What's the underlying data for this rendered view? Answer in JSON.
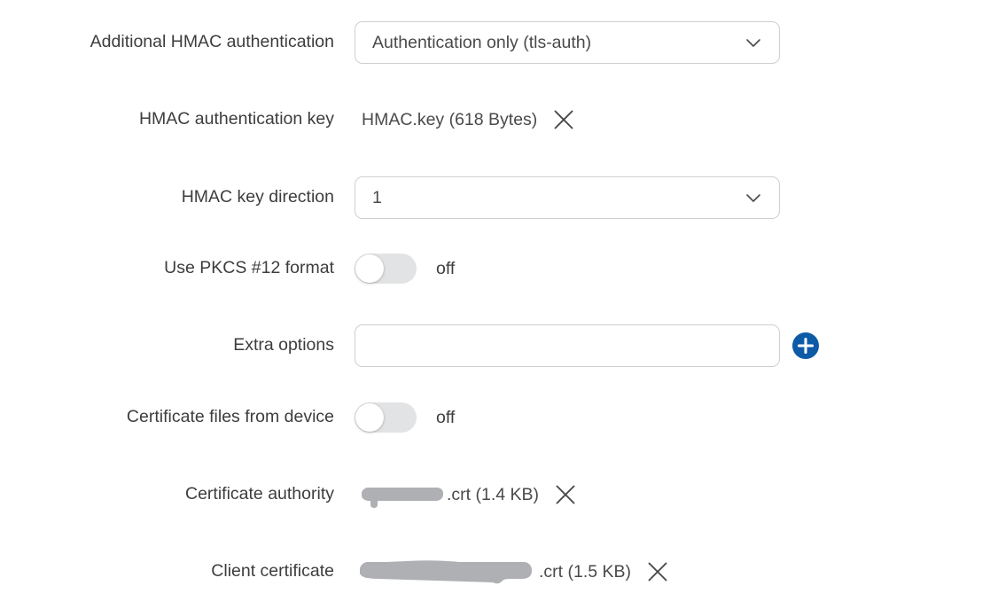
{
  "theme": {
    "background": "#ffffff",
    "label_color": "#3d3d3d",
    "value_color": "#4a4a4a",
    "border_color": "#cfcfcf",
    "accent_blue": "#0d5aa7",
    "toggle_track_off": "#e2e3e4",
    "toggle_knob": "#ffffff",
    "redaction_gray": "#aeb0b3",
    "icon_color": "#4a4a4a"
  },
  "form": {
    "rows": [
      {
        "id": "additional-hmac-authentication",
        "label": "Additional HMAC authentication",
        "type": "select",
        "value": "Authentication only (tls-auth)",
        "chevron_icon": "chevron-down-icon"
      },
      {
        "id": "hmac-authentication-key",
        "label": "HMAC authentication key",
        "type": "file",
        "filename": "HMAC.key",
        "size": "(618 Bytes)",
        "value": "HMAC.key (618 Bytes)",
        "redacted": false,
        "remove_icon": "close-icon"
      },
      {
        "id": "hmac-key-direction",
        "label": "HMAC key direction",
        "type": "select",
        "value": "1",
        "chevron_icon": "chevron-down-icon"
      },
      {
        "id": "use-pkcs-12-format",
        "label": "Use PKCS #12 format",
        "type": "toggle",
        "state": "off",
        "checked": false
      },
      {
        "id": "extra-options",
        "label": "Extra options",
        "type": "text-with-add",
        "value": "",
        "placeholder": "",
        "add_icon": "plus-icon"
      },
      {
        "id": "certificate-files-from-device",
        "label": "Certificate files from device",
        "type": "toggle",
        "state": "off",
        "checked": false
      },
      {
        "id": "certificate-authority",
        "label": "Certificate authority",
        "type": "file",
        "filename": "",
        "suffix": ".crt",
        "size": "(1.4 KB)",
        "value": ".crt (1.4 KB)",
        "redacted": true,
        "remove_icon": "close-icon"
      },
      {
        "id": "client-certificate",
        "label": "Client certificate",
        "type": "file",
        "filename": "",
        "suffix": ".crt",
        "size": "(1.5 KB)",
        "value": ".crt (1.5 KB)",
        "redacted": true,
        "remove_icon": "close-icon"
      }
    ]
  }
}
